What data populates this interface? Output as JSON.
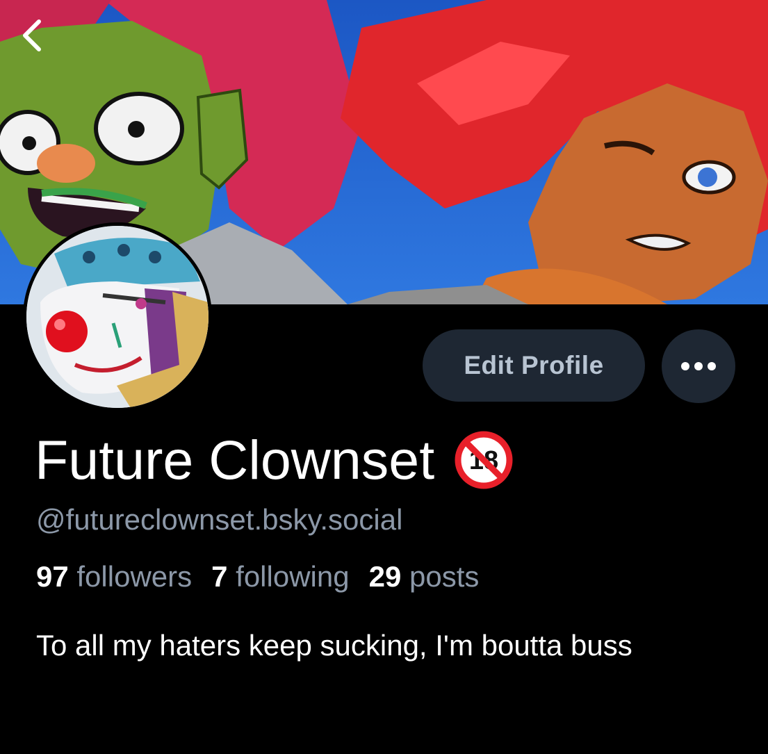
{
  "profile": {
    "display_name": "Future Clownset",
    "handle": "@futureclownset.bsky.social",
    "badge_icon": "eighteen-prohibited-icon",
    "bio": "To all my haters keep sucking, I'm boutta buss"
  },
  "stats": {
    "followers_count": "97",
    "followers_label": "followers",
    "following_count": "7",
    "following_label": "following",
    "posts_count": "29",
    "posts_label": "posts"
  },
  "actions": {
    "edit_profile_label": "Edit Profile",
    "more_icon": "ellipsis-icon",
    "back_icon": "chevron-left-icon"
  },
  "colors": {
    "background": "#000000",
    "button_bg": "#1e2733",
    "muted_text": "#8c98a8",
    "banner_sky": "#1f5ec9"
  }
}
